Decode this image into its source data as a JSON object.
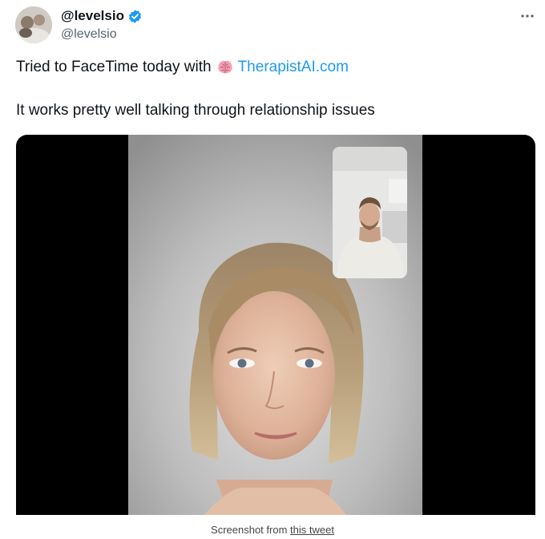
{
  "tweet": {
    "display_name": "@levelsio",
    "handle": "@levelsio",
    "text_line1_prefix": "Tried to FaceTime today with",
    "link_text": "TherapistAI.com",
    "text_line2": "It works pretty well talking through relationship issues"
  },
  "caption": {
    "prefix": "Screenshot from ",
    "link_text": "this tweet"
  },
  "icons": {
    "verified": "verified-badge-icon",
    "more": "more-dots-icon",
    "brain": "brain-emoji-icon"
  },
  "colors": {
    "text": "#0f1419",
    "secondary": "#536471",
    "link": "#1d9bf0",
    "verified": "#1d9bf0",
    "media_background": "#000000"
  }
}
